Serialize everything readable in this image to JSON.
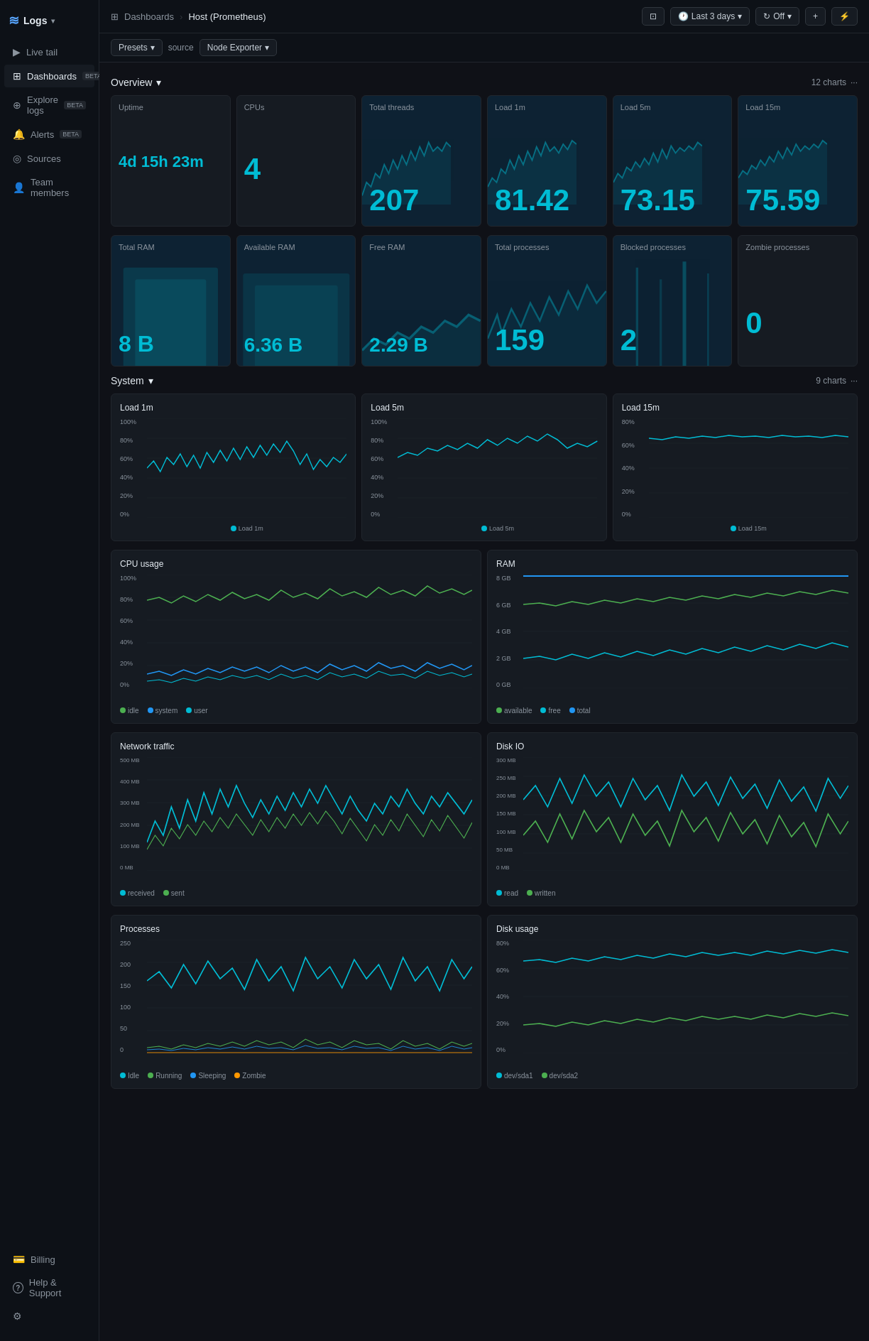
{
  "app": {
    "logo": "Logs",
    "logo_icon": "≋"
  },
  "sidebar": {
    "items": [
      {
        "id": "live-tail",
        "label": "Live tail",
        "icon": "▶",
        "badge": ""
      },
      {
        "id": "dashboards",
        "label": "Dashboards",
        "icon": "⊞",
        "badge": "BETA",
        "active": true
      },
      {
        "id": "explore-logs",
        "label": "Explore logs",
        "icon": "⊕",
        "badge": "BETA"
      },
      {
        "id": "alerts",
        "label": "Alerts",
        "icon": "🔔",
        "badge": "BETA"
      },
      {
        "id": "sources",
        "label": "Sources",
        "icon": "◎",
        "badge": ""
      },
      {
        "id": "team-members",
        "label": "Team members",
        "icon": "👤",
        "badge": ""
      }
    ],
    "bottom_items": [
      {
        "id": "billing",
        "label": "Billing",
        "icon": "💳"
      },
      {
        "id": "help-support",
        "label": "Help & Support",
        "icon": "?"
      },
      {
        "id": "settings",
        "label": "Settings",
        "icon": "⚙"
      }
    ]
  },
  "topbar": {
    "breadcrumb": [
      "Dashboards",
      "Host (Prometheus)"
    ],
    "breadcrumb_sep": ">",
    "page_icon": "⊞",
    "actions": {
      "time_range": "Last 3 days",
      "refresh": "Off",
      "add": "+",
      "more": "⚡"
    }
  },
  "toolbar": {
    "presets_label": "Presets",
    "source_label": "source",
    "source_value": "Node Exporter"
  },
  "overview_section": {
    "title": "Overview",
    "charts_count": "12 charts",
    "metrics": [
      {
        "id": "uptime",
        "label": "Uptime",
        "value": "4d 15h 23m",
        "style": "uptime"
      },
      {
        "id": "cpus",
        "label": "CPUs",
        "value": "4",
        "style": "large"
      },
      {
        "id": "total-threads",
        "label": "Total threads",
        "value": "207",
        "style": "large"
      },
      {
        "id": "load-1m",
        "label": "Load 1m",
        "value": "81.42",
        "style": "large"
      },
      {
        "id": "load-5m",
        "label": "Load 5m",
        "value": "73.15",
        "style": "large"
      },
      {
        "id": "load-15m",
        "label": "Load 15m",
        "value": "75.59",
        "style": "large"
      }
    ],
    "metrics2": [
      {
        "id": "total-ram",
        "label": "Total RAM",
        "value": "8 B",
        "style": "small-text"
      },
      {
        "id": "available-ram",
        "label": "Available RAM",
        "value": "6.36 B",
        "style": "small-text"
      },
      {
        "id": "free-ram",
        "label": "Free RAM",
        "value": "2.29 B",
        "style": "small-text"
      },
      {
        "id": "total-processes",
        "label": "Total processes",
        "value": "159",
        "style": "large"
      },
      {
        "id": "blocked-processes",
        "label": "Blocked processes",
        "value": "2",
        "style": "large"
      },
      {
        "id": "zombie-processes",
        "label": "Zombie processes",
        "value": "0",
        "style": "large"
      }
    ]
  },
  "system_section": {
    "title": "System",
    "charts_count": "9 charts",
    "charts": [
      {
        "id": "load-1m-chart",
        "title": "Load 1m",
        "y_labels": [
          "100%",
          "80%",
          "60%",
          "40%",
          "20%",
          "0%"
        ],
        "legend": [
          {
            "label": "Load 1m",
            "color": "#00bcd4"
          }
        ]
      },
      {
        "id": "load-5m-chart",
        "title": "Load 5m",
        "y_labels": [
          "100%",
          "80%",
          "60%",
          "40%",
          "20%",
          "0%"
        ],
        "legend": [
          {
            "label": "Load 5m",
            "color": "#00bcd4"
          }
        ]
      },
      {
        "id": "load-15m-chart",
        "title": "Load 15m",
        "y_labels": [
          "80%",
          "60%",
          "40%",
          "20%",
          "0%"
        ],
        "legend": [
          {
            "label": "Load 15m",
            "color": "#00bcd4"
          }
        ]
      }
    ],
    "charts2": [
      {
        "id": "cpu-usage",
        "title": "CPU usage",
        "y_labels": [
          "100%",
          "80%",
          "60%",
          "40%",
          "20%",
          "0%"
        ],
        "legend": [
          {
            "label": "idle",
            "color": "#4caf50"
          },
          {
            "label": "system",
            "color": "#2196f3"
          },
          {
            "label": "user",
            "color": "#00bcd4"
          }
        ]
      },
      {
        "id": "ram-chart",
        "title": "RAM",
        "y_labels": [
          "8 GB",
          "6 GB",
          "4 GB",
          "2 GB",
          "0 GB"
        ],
        "legend": [
          {
            "label": "available",
            "color": "#4caf50"
          },
          {
            "label": "free",
            "color": "#00bcd4"
          },
          {
            "label": "total",
            "color": "#2196f3"
          }
        ]
      },
      {
        "id": "network-traffic",
        "title": "Network traffic",
        "y_labels": [
          "500 MB",
          "400 MB",
          "300 MB",
          "200 MB",
          "100 MB",
          "0 MB"
        ],
        "legend": [
          {
            "label": "received",
            "color": "#00bcd4"
          },
          {
            "label": "sent",
            "color": "#4caf50"
          }
        ]
      },
      {
        "id": "disk-io",
        "title": "Disk IO",
        "y_labels": [
          "300 MB",
          "250 MB",
          "200 MB",
          "150 MB",
          "100 MB",
          "50 MB",
          "0 MB"
        ],
        "legend": [
          {
            "label": "read",
            "color": "#00bcd4"
          },
          {
            "label": "written",
            "color": "#4caf50"
          }
        ]
      },
      {
        "id": "processes-chart",
        "title": "Processes",
        "y_labels": [
          "250",
          "200",
          "150",
          "100",
          "50",
          "0"
        ],
        "legend": [
          {
            "label": "Idle",
            "color": "#00bcd4"
          },
          {
            "label": "Running",
            "color": "#4caf50"
          },
          {
            "label": "Sleeping",
            "color": "#2196f3"
          },
          {
            "label": "Zombie",
            "color": "#ff9800"
          }
        ]
      },
      {
        "id": "disk-usage",
        "title": "Disk usage",
        "y_labels": [
          "80%",
          "60%",
          "40%",
          "20%",
          "0%"
        ],
        "legend": [
          {
            "label": "dev/sda1",
            "color": "#00bcd4"
          },
          {
            "label": "dev/sda2",
            "color": "#4caf50"
          }
        ]
      }
    ]
  }
}
